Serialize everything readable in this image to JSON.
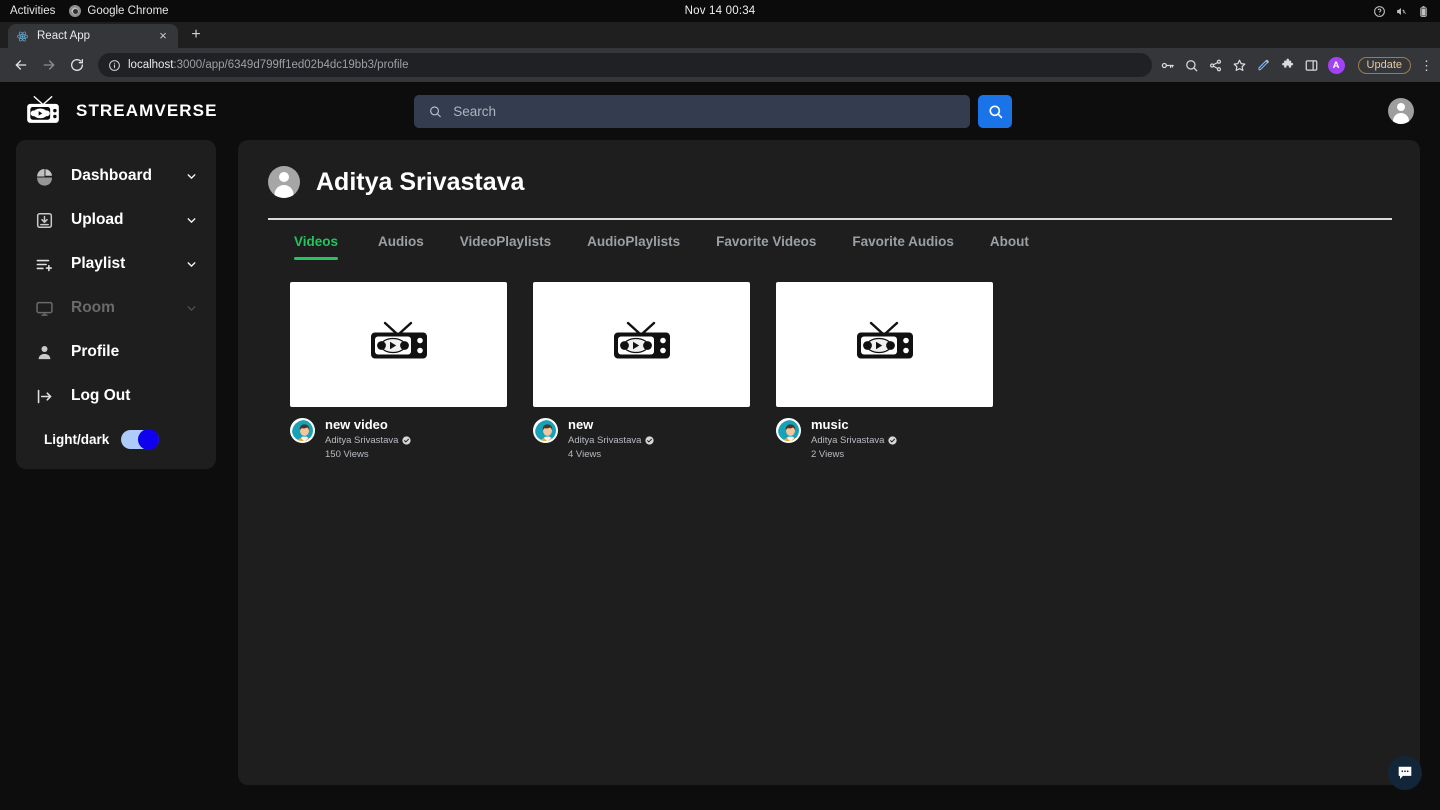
{
  "os_bar": {
    "activities": "Activities",
    "app_name": "Google Chrome",
    "clock": "Nov 14  00:34",
    "icons": [
      "help-icon",
      "volume-muted-icon",
      "battery-icon"
    ]
  },
  "browser": {
    "tab": {
      "title": "React App",
      "favicon": "react-icon",
      "close": "×"
    },
    "new_tab": "+",
    "nav": {
      "back": "back-arrow-icon",
      "forward": "forward-arrow-icon",
      "reload": "reload-icon"
    },
    "omnibox": {
      "info_icon": "site-info-icon",
      "url_host": "localhost",
      "url_rest": ":3000/app/6349d799ff1ed02b4dc19bb3/profile",
      "full_url": "localhost:3000/app/6349d799ff1ed02b4dc19bb3/profile"
    },
    "toolbar_icons": [
      "password-key-icon",
      "zoom-search-icon",
      "share-icon",
      "bookmark-star-icon",
      "pen-icon",
      "extensions-puzzle-icon",
      "side-panel-icon"
    ],
    "profile_initial": "A",
    "update_label": "Update",
    "menu": "⋮"
  },
  "app": {
    "brand": {
      "logo": "tv-logo-icon",
      "name": "STREAMVERSE"
    },
    "search": {
      "placeholder": "Search",
      "value": "",
      "icon": "search-icon",
      "button_icon": "search-icon"
    },
    "account_avatar": "user-avatar-icon"
  },
  "sidebar": {
    "items": [
      {
        "label": "Dashboard",
        "icon": "pie-chart-icon",
        "expandable": true,
        "disabled": false
      },
      {
        "label": "Upload",
        "icon": "upload-box-icon",
        "expandable": true,
        "disabled": false
      },
      {
        "label": "Playlist",
        "icon": "playlist-add-icon",
        "expandable": true,
        "disabled": false
      },
      {
        "label": "Room",
        "icon": "monitor-icon",
        "expandable": true,
        "disabled": true
      },
      {
        "label": "Profile",
        "icon": "person-icon",
        "expandable": false,
        "disabled": false
      },
      {
        "label": "Log Out",
        "icon": "logout-arrow-icon",
        "expandable": false,
        "disabled": false
      }
    ],
    "theme_toggle": {
      "label": "Light/dark",
      "state": "on",
      "track_color": "#aecbfa",
      "knob_color": "#0f00ee"
    }
  },
  "profile": {
    "avatar": "user-avatar-icon",
    "name": "Aditya Srivastava",
    "tabs": [
      {
        "label": "Videos",
        "active": true
      },
      {
        "label": "Audios",
        "active": false
      },
      {
        "label": "VideoPlaylists",
        "active": false
      },
      {
        "label": "AudioPlaylists",
        "active": false
      },
      {
        "label": "Favorite Videos",
        "active": false
      },
      {
        "label": "Favorite Audios",
        "active": false
      },
      {
        "label": "About",
        "active": false
      }
    ],
    "active_tab_color": "#22c55e"
  },
  "videos": [
    {
      "title": "new video",
      "channel": "Aditya Srivastava",
      "views": "150 Views",
      "verified": true,
      "thumb_icon": "tv-icon"
    },
    {
      "title": "new",
      "channel": "Aditya Srivastava",
      "views": "4 Views",
      "verified": true,
      "thumb_icon": "tv-icon"
    },
    {
      "title": "music",
      "channel": "Aditya Srivastava",
      "views": "2 Views",
      "verified": true,
      "thumb_icon": "tv-icon"
    }
  ],
  "chat_fab": {
    "icon": "chat-bubble-icon",
    "color": "#132639"
  }
}
